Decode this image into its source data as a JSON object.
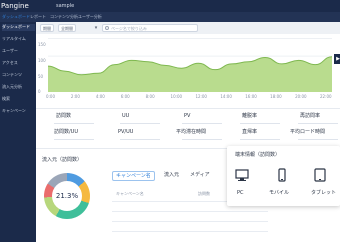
{
  "app": {
    "logo": "Pangine",
    "project": "sample"
  },
  "nav_tabs": [
    "ダッシュボード",
    "レポート",
    "コンテンツ分析",
    "ユーザー分析"
  ],
  "sidebar": {
    "items": [
      "ダッシュボード",
      "リアルタイム",
      "ユーザー",
      "アクセス",
      "コンテンツ",
      "流入元分析",
      "検索",
      "キャンペーン"
    ],
    "active_index": 0
  },
  "filters": {
    "chips": [
      "期間",
      "全期間"
    ],
    "search_placeholder": "ページ名で絞り込み"
  },
  "chart_data": {
    "type": "area",
    "title": "",
    "xlabel": "",
    "ylabel": "",
    "y_ticks": [
      "150",
      "100",
      "50",
      "0"
    ],
    "x": [
      "0:00",
      "2:00",
      "4:00",
      "6:00",
      "8:00",
      "10:00",
      "12:00",
      "14:00",
      "16:00",
      "18:00",
      "20:00",
      "22:00"
    ],
    "values": [
      72,
      58,
      48,
      52,
      76,
      88,
      84,
      74,
      66,
      80,
      62,
      78,
      84,
      96,
      78,
      88,
      76,
      98
    ],
    "ylim": [
      0,
      150
    ],
    "color": "#b9dc8e",
    "line_color": "#7fb850"
  },
  "metrics": {
    "row1": [
      "訪問数",
      "UU",
      "PV",
      "離脱率",
      "再訪問率"
    ],
    "row2": [
      "訪問数/UU",
      "PV/UU",
      "平均滞在時間",
      "直帰率",
      "平均ロード時間"
    ]
  },
  "traffic": {
    "title": "流入元（訪問数）",
    "percent": "21.3%",
    "tabs": [
      "キャンペーン名",
      "流入元",
      "メディア"
    ],
    "row_label": "キャンペーン名",
    "row_value": "訪問数"
  },
  "device_popup": {
    "title": "端末情報（訪問数）",
    "devices": [
      {
        "label": "PC",
        "icon": "desktop-icon"
      },
      {
        "label": "モバイル",
        "icon": "mobile-icon"
      },
      {
        "label": "タブレット",
        "icon": "tablet-icon"
      }
    ]
  },
  "colors": {
    "nav": "#1b2a4a",
    "accent": "#2f7fd8",
    "chart_fill": "#b9dc8e"
  }
}
